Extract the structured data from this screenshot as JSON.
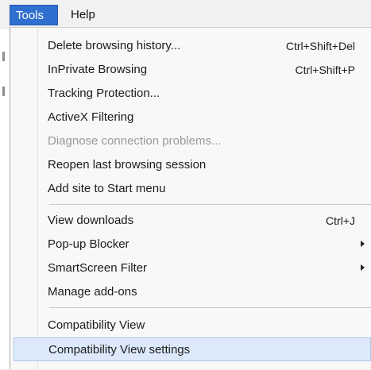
{
  "menubar": {
    "tools": "Tools",
    "help": "Help"
  },
  "menu": {
    "group1": [
      {
        "label": "Delete browsing history...",
        "shortcut": "Ctrl+Shift+Del"
      },
      {
        "label": "InPrivate Browsing",
        "shortcut": "Ctrl+Shift+P"
      },
      {
        "label": "Tracking Protection...",
        "shortcut": ""
      },
      {
        "label": "ActiveX Filtering",
        "shortcut": ""
      },
      {
        "label": "Diagnose connection problems...",
        "shortcut": ""
      },
      {
        "label": "Reopen last browsing session",
        "shortcut": ""
      },
      {
        "label": "Add site to Start menu",
        "shortcut": ""
      }
    ],
    "group2": [
      {
        "label": "View downloads",
        "shortcut": "Ctrl+J"
      },
      {
        "label": "Pop-up Blocker",
        "shortcut": ""
      },
      {
        "label": "SmartScreen Filter",
        "shortcut": ""
      },
      {
        "label": "Manage add-ons",
        "shortcut": ""
      }
    ],
    "group3": [
      {
        "label": "Compatibility View",
        "shortcut": ""
      },
      {
        "label": "Compatibility View settings",
        "shortcut": ""
      }
    ]
  },
  "icons": {
    "submenu": "chevron-right-icon"
  },
  "colors": {
    "selected_menu": "#2f6fcf",
    "hover_background": "#dce9fb",
    "disabled_text": "#9a9a9a"
  }
}
